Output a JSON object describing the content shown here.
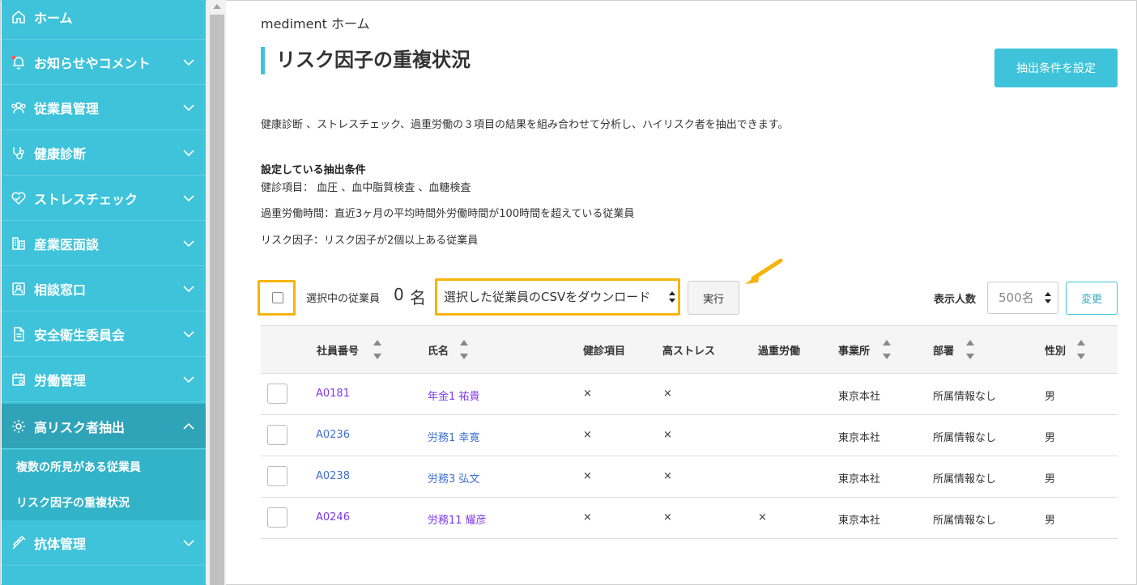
{
  "colors": {
    "accent": "#3ec3da",
    "highlight": "#f5b40a",
    "link_visited": "#7c3aed",
    "link": "#3f6fd0"
  },
  "sidebar": {
    "items": [
      {
        "label": "ホーム",
        "icon": "home-icon",
        "expandable": false
      },
      {
        "label": "お知らせやコメント",
        "icon": "bell-icon",
        "expandable": true
      },
      {
        "label": "従業員管理",
        "icon": "users-icon",
        "expandable": true
      },
      {
        "label": "健康診断",
        "icon": "stethoscope-icon",
        "expandable": true
      },
      {
        "label": "ストレスチェック",
        "icon": "heart-icon",
        "expandable": true
      },
      {
        "label": "産業医面談",
        "icon": "building-icon",
        "expandable": true
      },
      {
        "label": "相談窓口",
        "icon": "person-card-icon",
        "expandable": true
      },
      {
        "label": "安全衛生委員会",
        "icon": "document-icon",
        "expandable": true
      },
      {
        "label": "労働管理",
        "icon": "calendar-icon",
        "expandable": true
      },
      {
        "label": "高リスク者抽出",
        "icon": "gear-icon",
        "expandable": true,
        "expanded": true
      },
      {
        "label": "抗体管理",
        "icon": "syringe-icon",
        "expandable": true
      }
    ],
    "sub_items": [
      {
        "label": "複数の所見がある従業員"
      },
      {
        "label": "リスク因子の重複状況"
      }
    ]
  },
  "header": {
    "breadcrumb": "mediment ホーム",
    "title": "リスク因子の重複状況",
    "set_conditions_button": "抽出条件を設定"
  },
  "description": "健康診断 、ストレスチェック、過重労働の３項目の結果を組み合わせて分析し、ハイリスク者を抽出できます。",
  "conditions": {
    "title": "設定している抽出条件",
    "lines": [
      "健診項目： 血圧 、血中脂質検査 、血糖検査",
      "過重労働時間：直近3ヶ月の平均時間外労働時間が100時間を超えている従業員",
      "リスク因子：リスク因子が2個以上ある従業員"
    ]
  },
  "toolbar": {
    "selected_label": "選択中の従業員",
    "selected_count": "0",
    "selected_unit": "名",
    "action_select": "選択した従業員のCSVをダウンロード",
    "execute_button": "実行",
    "display_label": "表示人数",
    "display_value": "500名",
    "change_button": "変更"
  },
  "table": {
    "columns": [
      "社員番号",
      "氏名",
      "健診項目",
      "高ストレス",
      "過重労働",
      "事業所",
      "部署",
      "性別"
    ],
    "rows": [
      {
        "id": "A0181",
        "name": "年金1 祐貴",
        "kenshin": "×",
        "stress": "×",
        "overwork": "",
        "office": "東京本社",
        "dept": "所属情報なし",
        "sex": "男"
      },
      {
        "id": "A0236",
        "name": "労務1 幸寛",
        "kenshin": "×",
        "stress": "×",
        "overwork": "",
        "office": "東京本社",
        "dept": "所属情報なし",
        "sex": "男"
      },
      {
        "id": "A0238",
        "name": "労務3 弘文",
        "kenshin": "×",
        "stress": "×",
        "overwork": "",
        "office": "東京本社",
        "dept": "所属情報なし",
        "sex": "男"
      },
      {
        "id": "A0246",
        "name": "労務11 耀彦",
        "kenshin": "×",
        "stress": "×",
        "overwork": "×",
        "office": "東京本社",
        "dept": "所属情報なし",
        "sex": "男"
      }
    ]
  }
}
